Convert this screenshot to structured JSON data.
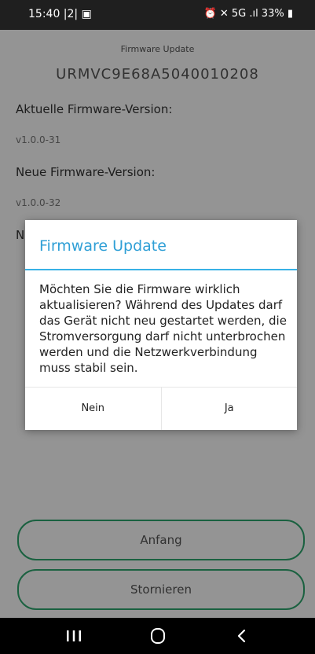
{
  "status_bar": {
    "time": "15:40 |2| ▣",
    "right": "⏰ ✕ 5G .ıl 33% ▮"
  },
  "screen": {
    "app_title": "Firmware Update",
    "serial": "URMVC9E68A5040010208",
    "current_label": "Aktuelle Firmware-Version:",
    "current_value": "v1.0.0-31",
    "new_label": "Neue Firmware-Version:",
    "new_value": "v1.0.0-32",
    "partial_label": "N",
    "home_button": "Anfang",
    "cancel_button": "Stornieren"
  },
  "dialog": {
    "title": "Firmware Update",
    "message": "Möchten Sie die Firmware wirklich aktualisieren? Während des Updates darf das Gerät nicht neu gestartet werden, die Stromversorgung darf nicht unterbrochen werden und die Netzwerkverbindung muss stabil sein.",
    "no_label": "Nein",
    "yes_label": "Ja"
  },
  "nav": {
    "icons": [
      "recents-icon",
      "home-icon",
      "back-icon"
    ]
  },
  "colors": {
    "accent": "#2f9fd6",
    "outline_green": "#2ea86e"
  }
}
